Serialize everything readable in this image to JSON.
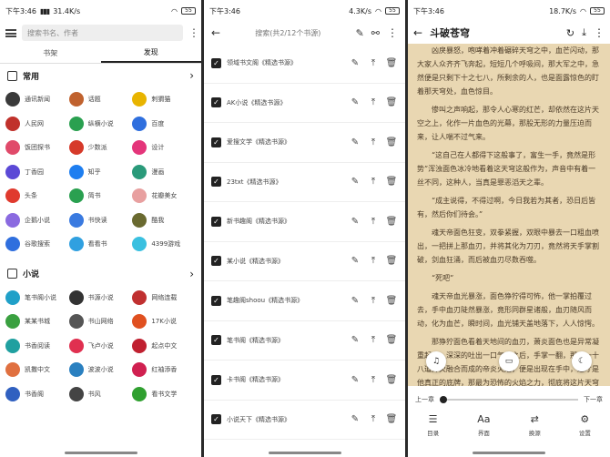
{
  "status_bar": [
    {
      "time": "下午3:46",
      "speed": "31.4K/s",
      "battery": "55"
    },
    {
      "time": "下午3:46",
      "speed": "4.3K/s",
      "battery": "55"
    },
    {
      "time": "下午3:46",
      "speed": "18.7K/s",
      "battery": "55"
    }
  ],
  "library": {
    "search_placeholder": "搜索书名、作者",
    "tabs": [
      "书架",
      "发现"
    ],
    "active_tab": "发现",
    "sections": [
      {
        "title": "常用",
        "sites": [
          {
            "name": "通讯新闻",
            "color": "#3a3a3a"
          },
          {
            "name": "话题",
            "color": "#c0622e"
          },
          {
            "name": "刺猬猫",
            "color": "#e8b400"
          },
          {
            "name": "人民网",
            "color": "#c0312b"
          },
          {
            "name": "纵横小说",
            "color": "#2aa050"
          },
          {
            "name": "百度",
            "color": "#2f6fde"
          },
          {
            "name": "饭团探书",
            "color": "#e04a6a"
          },
          {
            "name": "少数派",
            "color": "#d63a2a"
          },
          {
            "name": "设计",
            "color": "#e4357a"
          },
          {
            "name": "丁香园",
            "color": "#5b49d6"
          },
          {
            "name": "知乎",
            "color": "#1e7ef0"
          },
          {
            "name": "漫画",
            "color": "#2a9a7a"
          },
          {
            "name": "头条",
            "color": "#e03a2e"
          },
          {
            "name": "简书",
            "color": "#2aa050"
          },
          {
            "name": "花瓣美女",
            "color": "#e8a0a0"
          },
          {
            "name": "企鹅小说",
            "color": "#8a6ae0"
          },
          {
            "name": "书快读",
            "color": "#3a7ae0"
          },
          {
            "name": "酷我",
            "color": "#6a6a30"
          },
          {
            "name": "谷歌搜索",
            "color": "#2f6fde"
          },
          {
            "name": "看看书",
            "color": "#30a0e0"
          },
          {
            "name": "4399游戏",
            "color": "#3ac0e0"
          }
        ]
      },
      {
        "title": "小说",
        "sites": [
          {
            "name": "笔书阁小说",
            "color": "#20a0c8"
          },
          {
            "name": "书源小说",
            "color": "#333333"
          },
          {
            "name": "网络连载",
            "color": "#c03030"
          },
          {
            "name": "某某书城",
            "color": "#3aa040"
          },
          {
            "name": "书山网络",
            "color": "#555555"
          },
          {
            "name": "17K小说",
            "color": "#e05020"
          },
          {
            "name": "书香阅读",
            "color": "#20a0a0"
          },
          {
            "name": "飞卢小说",
            "color": "#e03050"
          },
          {
            "name": "起点中文",
            "color": "#c02030"
          },
          {
            "name": "凯撒中文",
            "color": "#e07040"
          },
          {
            "name": "波波小说",
            "color": "#2a80c0"
          },
          {
            "name": "红袖添香",
            "color": "#d02050"
          },
          {
            "name": "书香阁",
            "color": "#3060c0"
          },
          {
            "name": "书风",
            "color": "#444444"
          },
          {
            "name": "看书文学",
            "color": "#30a030"
          }
        ]
      }
    ]
  },
  "search_results": {
    "title": "搜索(共2/12个书源)",
    "items": [
      "领域书文阁《精选书源》",
      "AK小说《精选书源》",
      "爱搜文学《精选书源》",
      "23txt《精选书源》",
      "新书趣阁《精选书源》",
      "某小说《精选书源》",
      "笔趣阁shoou《精选书源》",
      "笔书阁《精选书源》",
      "卡书阁《精选书源》",
      "小说天下《精选书源》"
    ]
  },
  "reader": {
    "title": "斗破苍穹",
    "paragraphs": [
      "凶戾暴怒，咆哮着冲着碾碎天穹之中，血芒闪动，那大家人众齐齐飞奔起，短短几个呼吸间，那大军之中，急然便是只剩下十之七八，所剩余的人，也是面露惊色的盯着那天穹处，血色惊目。",
      "惨叫之声响起，那令人心寒的红芒，却依然在这片天空之上，化作一片血色的光幕，那股无形的力量压迫而来，让人喘不过气来。",
      "“这自己在人都得下这般事了，富生一手，竟然是形势”浑浊面色冰冷地看着这天穹这般作为，声音中有着一丝不同，这种人，当真是罪恶滔天之辈。",
      "“成主说得，不得过啊，今日我若为其者，恐日后皆有，然后你们待会。”",
      "魂天帝面色狂变，双拳紧握，双眼中暴去一口粗血喷出，一把拼上那血刃，并将其化为刀刃，竟然将天手掌割破，剑血狂涌，而后被血刃尽数吞噬。",
      "“死吧”",
      "魂天帝血光暴涨，面色狰狞得可怖，他一掌拍覆过去，手中血刃陡然暴涨，竟形同群星诸般，血刃随风而动，化为血芒，瞬时间，血光铺天盖地落下，人人惊愕。",
      "那狰狞面色看着天地间的血刃，萧炎面色也是异常凝重起来，深深的吐出一口气息之后，手掌一翻，那由一十八道异火融合而成的帝炎火焰，便是出现在手中，这才是他真正的底牌，那最为恐怖的火焰之力，彻底将这片天穹笼罩在了火海之中了。"
    ],
    "prev_chapter": "上一章",
    "next_chapter": "下一章",
    "progress": 0.0,
    "menu": [
      "目录",
      "界面",
      "换源",
      "设置"
    ]
  }
}
